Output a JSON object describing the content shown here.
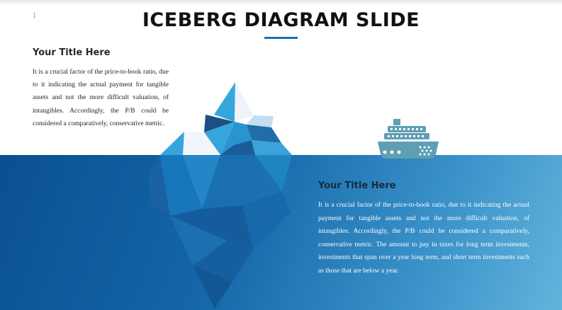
{
  "slide": {
    "number": "1",
    "title": "ICEBERG DIAGRAM SLIDE"
  },
  "left_block": {
    "title": "Your Title Here",
    "text": "It is a crucial factor of the price-to-book ratio, due to it indicating the actual payment for tangible assets and not the more difficult valuation, of intangibles. Accordingly, the P/B could be considered a comparatively, conservative metric."
  },
  "right_block": {
    "title": "Your Title Here",
    "text": "It is a crucial factor of the price-to-book ratio, due to it indicating the actual payment for tangible assets and not the more difficult valuation, of intangibles. Accordingly, the P/B could be considered a comparatively, conservative metric. The amount to pay in taxes for long term investments, investments that span over a year long term, and short term investments such as those that are below a year."
  },
  "icons": {
    "iceberg": "iceberg-illustration",
    "ship": "cruise-ship-icon"
  },
  "colors": {
    "accent": "#1f6fad",
    "water_dark": "#0a4f93",
    "water_light": "#62b4dc",
    "ice_light": "#eef4fa",
    "ice_mid": "#35a6dc",
    "ice_dark": "#1d4f82",
    "ship": "#5f9fb4"
  }
}
